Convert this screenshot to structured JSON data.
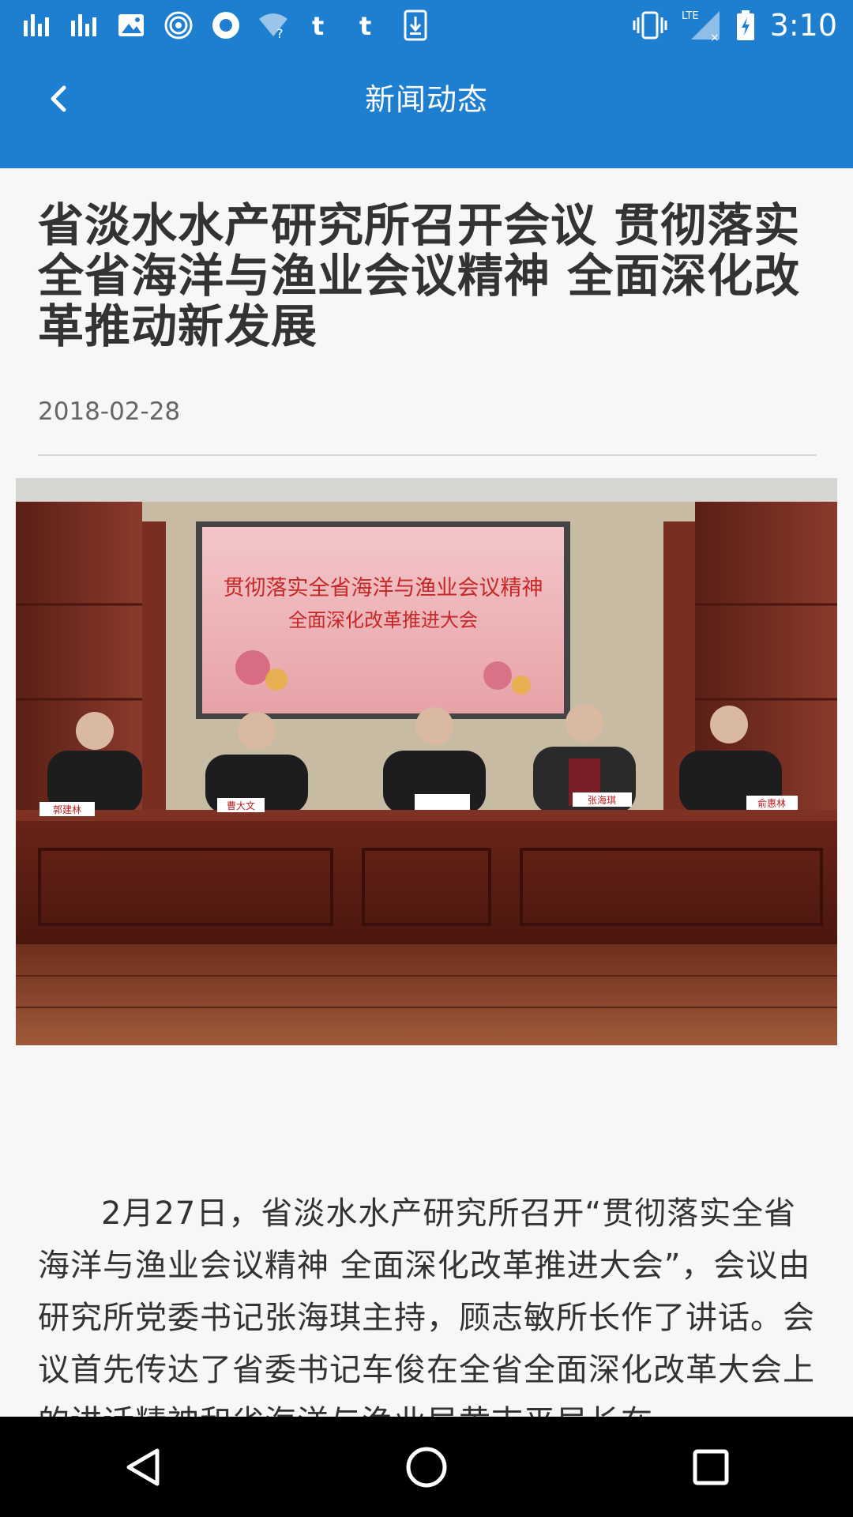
{
  "status_bar": {
    "time": "3:10",
    "left_icons": [
      "signal-bars-icon",
      "signal-bars-icon",
      "image-icon",
      "swirl-icon",
      "circle-app-icon",
      "wifi-question-icon",
      "tumblr-icon",
      "tumblr-icon",
      "download-icon"
    ],
    "right_icons": [
      "vibrate-icon",
      "lte-signal-icon",
      "battery-charging-icon"
    ],
    "lte_label": "LTE"
  },
  "app_bar": {
    "title": "新闻动态",
    "back_icon": "chevron-left-icon",
    "color": "#1e7fd0"
  },
  "article": {
    "title": "省淡水水产研究所召开会议 贯彻落实全省海洋与渔业会议精神 全面深化改革推动新发展",
    "date": "2018-02-28",
    "photo": {
      "banner_line1": "贯彻落实全省海洋与渔业会议精神",
      "banner_line2": "全面深化改革推进大会",
      "nameplates": [
        "郭建林",
        "曹大文",
        "",
        "张海琪",
        "俞惠林"
      ]
    },
    "body": "2月27日，省淡水水产研究所召开“贯彻落实全省海洋与渔业会议精神 全面深化改革推进大会”，会议由研究所党委书记张海琪主持，顾志敏所长作了讲话。会议首先传达了省委书记车俊在全省全面深化改革大会上的讲话精神和省海洋与渔业局黄志平局长在"
  },
  "nav_bar": {
    "back_icon": "triangle-back-icon",
    "home_icon": "circle-home-icon",
    "recents_icon": "square-recents-icon"
  }
}
